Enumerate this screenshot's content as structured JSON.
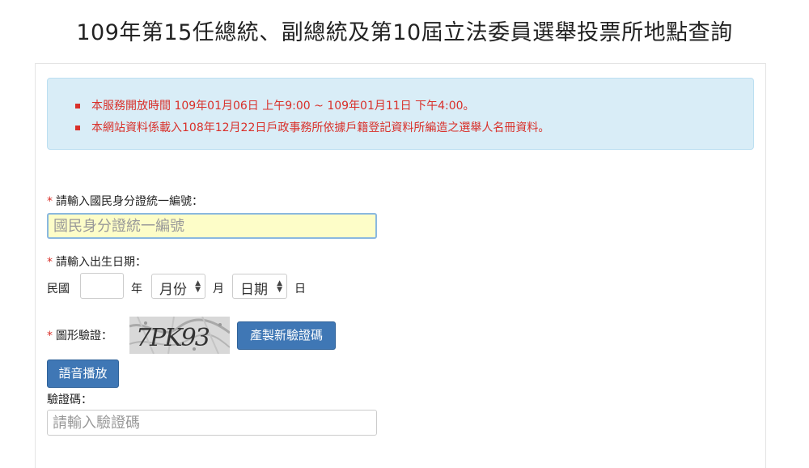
{
  "page": {
    "title": "109年第15任總統、副總統及第10屆立法委員選舉投票所地點查詢"
  },
  "notice": {
    "items": [
      "本服務開放時間 109年01月06日 上午9:00 ~ 109年01月11日 下午4:00。",
      "本網站資料係載入108年12月22日戶政事務所依據戶籍登記資料所編造之選舉人名冊資料。"
    ],
    "color": "#d9302a",
    "background": "#d9edf7"
  },
  "form": {
    "required_mark": "*",
    "id_number": {
      "label": "請輸入國民身分證統一編號：",
      "placeholder": "國民身分證統一編號",
      "value": ""
    },
    "birthdate": {
      "label": "請輸入出生日期：",
      "era_label": "民國",
      "year_value": "",
      "year_unit": "年",
      "month_selected": "月份",
      "month_unit": "月",
      "day_selected": "日期",
      "day_unit": "日"
    },
    "captcha": {
      "label": "圖形驗證：",
      "image_text": "7PK93",
      "refresh_button": "產製新驗證碼",
      "audio_button": "語音播放",
      "input_label": "驗證碼：",
      "input_placeholder": "請輸入驗證碼",
      "input_value": ""
    },
    "button_color": "#3f77b5"
  }
}
